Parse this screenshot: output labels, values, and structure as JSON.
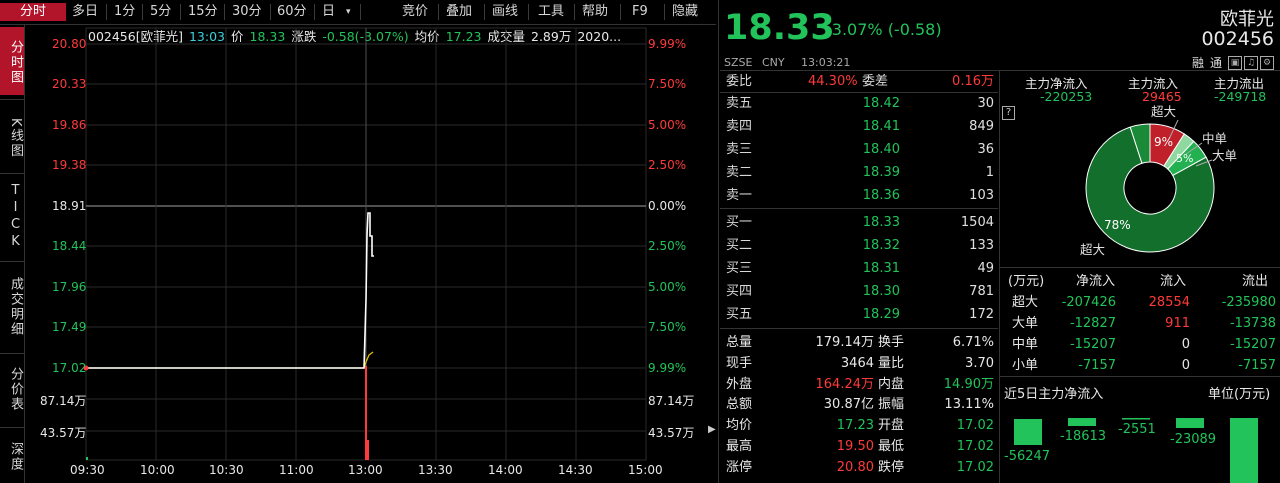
{
  "toolbar": {
    "tabs": [
      "分时",
      "多日",
      "1分",
      "5分",
      "15分",
      "30分",
      "60分",
      "日",
      "竞价",
      "叠加",
      "画线",
      "工具",
      "帮助",
      "F9",
      "隐藏"
    ],
    "dropdown_glyph": "▾"
  },
  "sidebar": {
    "items": [
      "分时图",
      "K线图",
      "TICK",
      "成交明细",
      "分价表",
      "深度"
    ]
  },
  "infobar": {
    "code_name": "002456[欧菲光]",
    "time": "13:03",
    "price_label": "价",
    "price": "18.33",
    "change_label": "涨跌",
    "change": "-0.58(-3.07%)",
    "avg_label": "均价",
    "avg": "17.23",
    "vol_label": "成交量",
    "vol": "2.89万",
    "date": "2020..."
  },
  "chart": {
    "price_ticks": [
      "20.80",
      "20.33",
      "19.86",
      "19.38",
      "18.91",
      "18.44",
      "17.96",
      "17.49",
      "17.02"
    ],
    "pct_ticks": [
      "9.99%",
      "7.50%",
      "5.00%",
      "2.50%",
      "0.00%",
      "2.50%",
      "5.00%",
      "7.50%",
      "9.99%"
    ],
    "vol_ticks": [
      "87.14万",
      "43.57万"
    ],
    "time_ticks": [
      "09:30",
      "10:00",
      "10:30",
      "11:00",
      "13:00",
      "13:30",
      "14:00",
      "14:30",
      "15:00"
    ],
    "colors": {
      "up": "#ff3a3a",
      "down": "#22c35a",
      "price_line": "#ffffff",
      "avg_line": "#e8c000",
      "grid": "#2a2a2a"
    }
  },
  "quote": {
    "price": "18.33",
    "change": "-3.07% (-0.58)",
    "name": "欧菲光",
    "code": "002456",
    "exchange": "SZSE",
    "currency": "CNY",
    "time": "13:03:21",
    "icons": [
      "融",
      "通"
    ]
  },
  "orderbook": {
    "webi_label": "委比",
    "webi": "44.30%",
    "weicha_label": "委差",
    "weicha": "0.16万",
    "sells": [
      {
        "name": "卖五",
        "price": "18.42",
        "vol": "30"
      },
      {
        "name": "卖四",
        "price": "18.41",
        "vol": "849"
      },
      {
        "name": "卖三",
        "price": "18.40",
        "vol": "36"
      },
      {
        "name": "卖二",
        "price": "18.39",
        "vol": "1"
      },
      {
        "name": "卖一",
        "price": "18.36",
        "vol": "103"
      }
    ],
    "buys": [
      {
        "name": "买一",
        "price": "18.33",
        "vol": "1504"
      },
      {
        "name": "买二",
        "price": "18.32",
        "vol": "133"
      },
      {
        "name": "买三",
        "price": "18.31",
        "vol": "49"
      },
      {
        "name": "买四",
        "price": "18.30",
        "vol": "781"
      },
      {
        "name": "买五",
        "price": "18.29",
        "vol": "172"
      }
    ]
  },
  "stats": [
    {
      "l1": "总量",
      "v1": "179.14万",
      "c1": "w",
      "l2": "换手",
      "v2": "6.71%",
      "c2": "w"
    },
    {
      "l1": "现手",
      "v1": "3464",
      "c1": "w",
      "l2": "量比",
      "v2": "3.70",
      "c2": "w"
    },
    {
      "l1": "外盘",
      "v1": "164.24万",
      "c1": "r",
      "l2": "内盘",
      "v2": "14.90万",
      "c2": "g"
    },
    {
      "l1": "总额",
      "v1": "30.87亿",
      "c1": "w",
      "l2": "振幅",
      "v2": "13.11%",
      "c2": "w"
    },
    {
      "l1": "均价",
      "v1": "17.23",
      "c1": "g",
      "l2": "开盘",
      "v2": "17.02",
      "c2": "g"
    },
    {
      "l1": "最高",
      "v1": "19.50",
      "c1": "r",
      "l2": "最低",
      "v2": "17.02",
      "c2": "g"
    },
    {
      "l1": "涨停",
      "v1": "20.80",
      "c1": "r",
      "l2": "跌停",
      "v2": "17.02",
      "c2": "g"
    }
  ],
  "fund_flow": {
    "headers": [
      "主力净流入",
      "主力流入",
      "主力流出"
    ],
    "values": [
      "-220253",
      "29465",
      "-249718"
    ],
    "help_glyph": "?",
    "pie": {
      "slices": [
        {
          "label": "超大",
          "pct": 9,
          "color": "#c0202a"
        },
        {
          "label": "中单",
          "pct": 3,
          "color": "#8fd9a0"
        },
        {
          "label": "大单",
          "pct": 5,
          "color": "#22b050"
        },
        {
          "label": "超大",
          "pct": 78,
          "color": "#13702c"
        },
        {
          "label": "",
          "pct": 5,
          "color": "#1a8a38"
        }
      ],
      "pct_labels": [
        "9%",
        "5%",
        "78%"
      ],
      "callouts": [
        "超大",
        "中单",
        "大单",
        "超大"
      ]
    },
    "table": {
      "headers": [
        "(万元)",
        "净流入",
        "流入",
        "流出"
      ],
      "rows": [
        {
          "name": "超大",
          "net": "-207426",
          "in": "28554",
          "out": "-235980"
        },
        {
          "name": "大单",
          "net": "-12827",
          "in": "911",
          "out": "-13738"
        },
        {
          "name": "中单",
          "net": "-15207",
          "in": "0",
          "out": "-15207"
        },
        {
          "name": "小单",
          "net": "-7157",
          "in": "0",
          "out": "-7157"
        }
      ]
    },
    "five_day": {
      "title": "近5日主力净流入",
      "unit": "单位(万元)",
      "values": [
        "-56247",
        "-18613",
        "-2551",
        "-23089",
        ""
      ]
    }
  }
}
